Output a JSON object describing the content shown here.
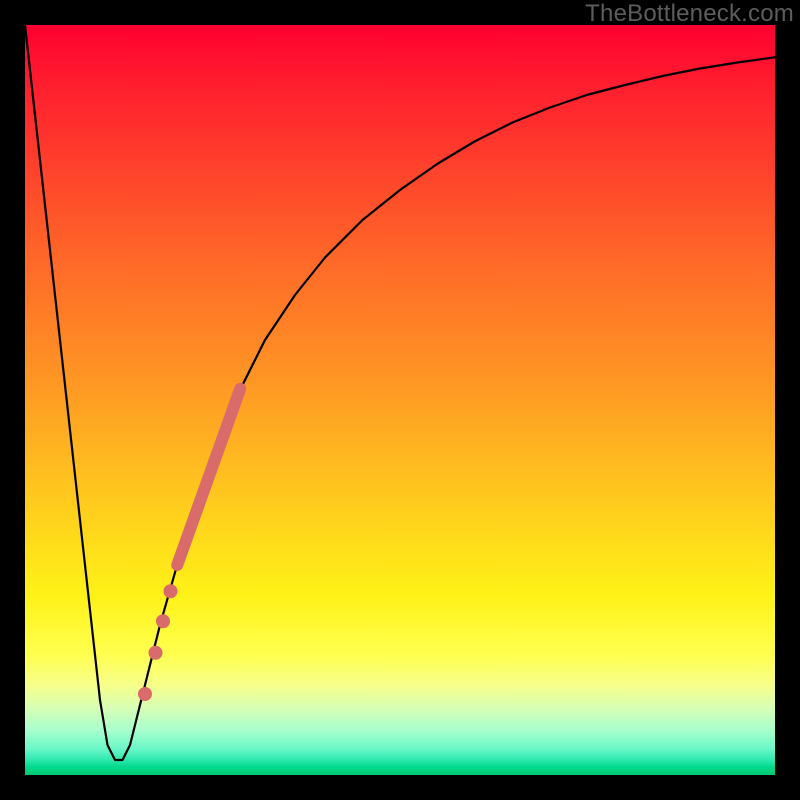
{
  "watermark": "TheBottleneck.com",
  "chart_data": {
    "type": "line",
    "title": "",
    "xlabel": "",
    "ylabel": "",
    "xlim": [
      0,
      100
    ],
    "ylim": [
      0,
      100
    ],
    "grid": false,
    "legend": false,
    "series": [
      {
        "name": "bottleneck-curve",
        "x": [
          0,
          2,
          4,
          6,
          8,
          10,
          11,
          12,
          13,
          14,
          16,
          18,
          20,
          22,
          25,
          28,
          32,
          36,
          40,
          45,
          50,
          55,
          60,
          65,
          70,
          75,
          80,
          85,
          90,
          95,
          100
        ],
        "y": [
          100,
          82,
          64,
          46,
          28,
          10,
          4,
          2,
          2,
          4,
          12,
          20,
          27,
          34,
          43,
          50,
          58,
          64,
          69,
          74,
          78,
          81.5,
          84.5,
          87,
          89,
          90.7,
          92,
          93.2,
          94.2,
          95,
          95.7
        ],
        "stroke": "#000000",
        "stroke_width": 2.2
      }
    ],
    "markers": [
      {
        "name": "thick-highlight-segment",
        "x": [
          20.3,
          28.7
        ],
        "y": [
          28.0,
          51.5
        ],
        "stroke": "#d96b6b",
        "stroke_width": 12
      },
      {
        "name": "dot-1",
        "cx": 19.4,
        "cy": 24.5,
        "r": 7,
        "fill": "#d96b6b"
      },
      {
        "name": "dot-2",
        "cx": 18.4,
        "cy": 20.5,
        "r": 7,
        "fill": "#d96b6b"
      },
      {
        "name": "dot-3",
        "cx": 17.4,
        "cy": 16.3,
        "r": 7,
        "fill": "#d96b6b"
      },
      {
        "name": "dot-4",
        "cx": 16.0,
        "cy": 10.8,
        "r": 7,
        "fill": "#d96b6b"
      }
    ]
  }
}
